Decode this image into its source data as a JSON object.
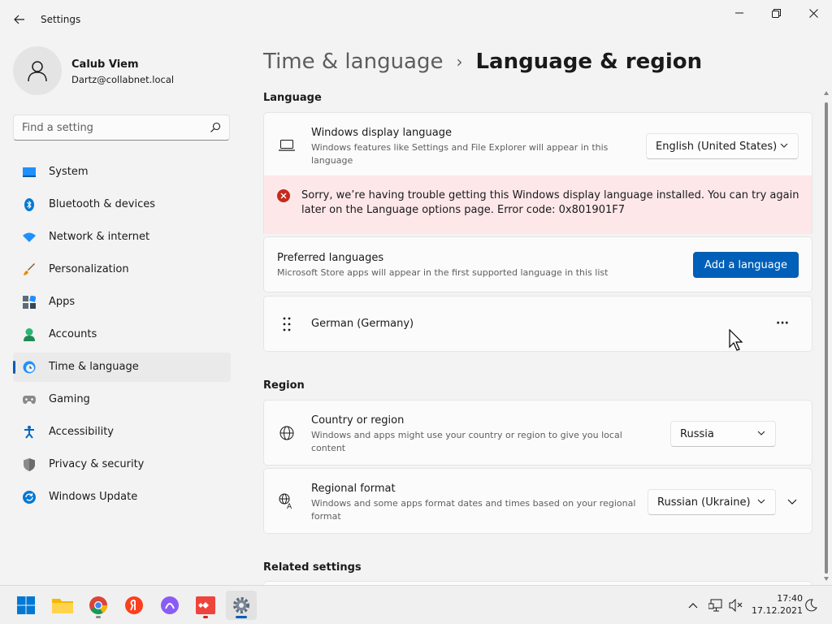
{
  "window": {
    "app_title": "Settings"
  },
  "profile": {
    "name": "Calub Viem",
    "email": "Dartz@collabnet.local"
  },
  "search": {
    "placeholder": "Find a setting"
  },
  "sidebar": {
    "items": [
      {
        "label": "System",
        "icon": "system-icon"
      },
      {
        "label": "Bluetooth & devices",
        "icon": "bluetooth-icon"
      },
      {
        "label": "Network & internet",
        "icon": "wifi-icon"
      },
      {
        "label": "Personalization",
        "icon": "brush-icon"
      },
      {
        "label": "Apps",
        "icon": "apps-icon"
      },
      {
        "label": "Accounts",
        "icon": "accounts-icon"
      },
      {
        "label": "Time & language",
        "icon": "time-language-icon",
        "active": true
      },
      {
        "label": "Gaming",
        "icon": "gamepad-icon"
      },
      {
        "label": "Accessibility",
        "icon": "accessibility-icon"
      },
      {
        "label": "Privacy & security",
        "icon": "shield-icon"
      },
      {
        "label": "Windows Update",
        "icon": "update-icon"
      }
    ]
  },
  "breadcrumb": {
    "parent": "Time & language",
    "separator": "›",
    "current": "Language & region"
  },
  "language_section": {
    "title": "Language",
    "display_language": {
      "title": "Windows display language",
      "description": "Windows features like Settings and File Explorer will appear in this language",
      "value": "English (United States)"
    },
    "error": {
      "message": "Sorry, we’re having trouble getting this Windows display language installed. You can try again later on the Language options page. Error code: 0x801901F7"
    },
    "preferred": {
      "title": "Preferred languages",
      "description": "Microsoft Store apps will appear in the first supported language in this list",
      "button": "Add a language"
    },
    "languages": [
      {
        "name": "German (Germany)"
      }
    ],
    "more_label": "···"
  },
  "region_section": {
    "title": "Region",
    "country": {
      "title": "Country or region",
      "description": "Windows and apps might use your country or region to give you local content",
      "value": "Russia"
    },
    "format": {
      "title": "Regional format",
      "description": "Windows and some apps format dates and times based on your regional format",
      "value": "Russian (Ukraine)"
    }
  },
  "related": {
    "title": "Related settings"
  },
  "taskbar": {
    "apps": [
      "start-icon",
      "file-explorer-icon",
      "chrome-icon",
      "yandex-browser-icon",
      "alice-icon",
      "anydesk-icon",
      "settings-icon"
    ],
    "time": "17:40",
    "date": "17.12.2021"
  },
  "colors": {
    "accent": "#005fb8",
    "error_bg": "#fde7e9",
    "error_icon": "#c42b1c"
  }
}
